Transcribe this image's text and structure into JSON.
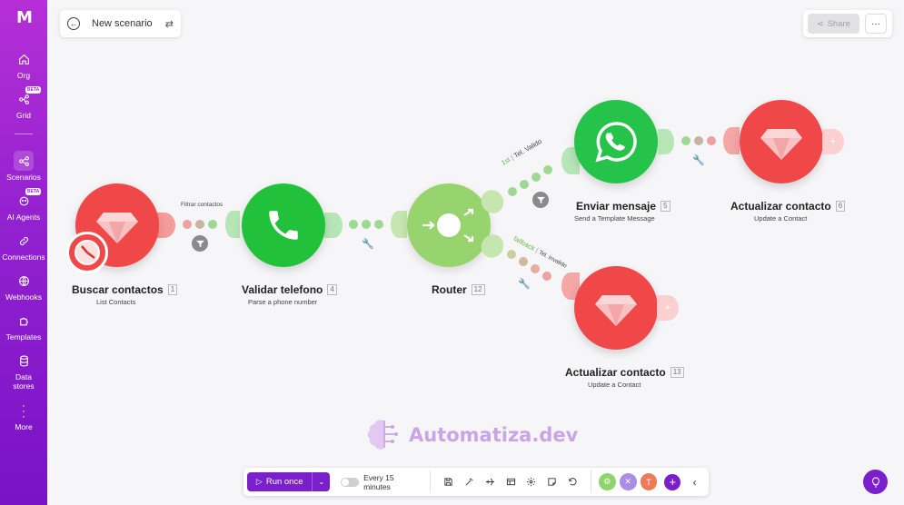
{
  "app": {
    "logo": "M"
  },
  "sidebar": {
    "items": [
      {
        "label": "Org",
        "icon": "home-icon"
      },
      {
        "label": "Grid",
        "icon": "grid-icon",
        "badge": "BETA"
      },
      {
        "label": "Scenarios",
        "icon": "share-nodes-icon",
        "active": true
      },
      {
        "label": "AI Agents",
        "icon": "ai-agent-icon",
        "badge": "BETA"
      },
      {
        "label": "Connections",
        "icon": "link-icon"
      },
      {
        "label": "Webhooks",
        "icon": "globe-icon"
      },
      {
        "label": "Templates",
        "icon": "puzzle-icon"
      },
      {
        "label": "Data stores",
        "icon": "database-icon"
      },
      {
        "label": "More",
        "icon": "more-vertical-icon"
      }
    ]
  },
  "header": {
    "scenario_name": "New scenario",
    "share_label": "Share",
    "more_label": "···"
  },
  "nodes": {
    "buscar": {
      "title": "Buscar contactos",
      "num": "1",
      "sub": "List Contacts"
    },
    "validar": {
      "title": "Validar telefono",
      "num": "4",
      "sub": "Parse a phone number"
    },
    "router": {
      "title": "Router",
      "num": "12"
    },
    "enviar": {
      "title": "Enviar mensaje",
      "num": "5",
      "sub": "Send a Template Message"
    },
    "actualizar6": {
      "title": "Actualizar contacto",
      "num": "6",
      "sub": "Update a Contact"
    },
    "actualizar13": {
      "title": "Actualizar contacto",
      "num": "13",
      "sub": "Update a Contact"
    }
  },
  "links": {
    "filter1": "Filtrar contactos",
    "route1_order": "1st",
    "route1_label": "Tel. Valido",
    "route2_order": "fallback",
    "route2_label": "Tel. invalido"
  },
  "watermark": {
    "text": "Automatiza.dev"
  },
  "toolbar": {
    "run_label": "Run once",
    "schedule_label": "Every 15 minutes"
  },
  "colors": {
    "brand": "#7a1fcc",
    "sidebar_top": "#b52fd6",
    "hubspot_red": "#f04848",
    "whatsapp_green": "#25c349",
    "router_green": "#98d46e"
  }
}
